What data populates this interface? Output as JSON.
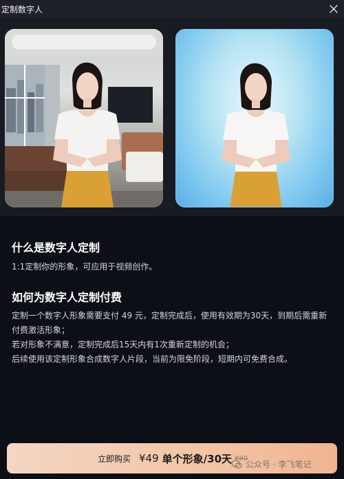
{
  "window": {
    "title": "定制数字人"
  },
  "icons": {
    "close": "close-icon",
    "wechat": "wechat-logo-icon"
  },
  "info": {
    "heading1": "什么是数字人定制",
    "desc1": "1:1定制你的形象，可应用于视频创作。",
    "heading2": "如何为数字人定制付费",
    "paragraphs": [
      "定制一个数字人形象需要支付 49 元，定制完成后，使用有效期为30天，到期后需重新付费激活形象；",
      "若对形象不满意，定制完成后15天内有1次重新定制的机会；",
      "后续使用该定制形象合成数字人片段，当前为限免阶段，短期内可免费合成。"
    ]
  },
  "buy": {
    "label": "立即购买",
    "price": "¥49",
    "plan": "单个形象/30天",
    "original": "¥80"
  },
  "watermark": {
    "text": "公众号 · 李飞笔记"
  },
  "colors": {
    "accent_start": "#f4d6c4",
    "accent_end": "#f0b58f",
    "background": "#0c0f16"
  }
}
